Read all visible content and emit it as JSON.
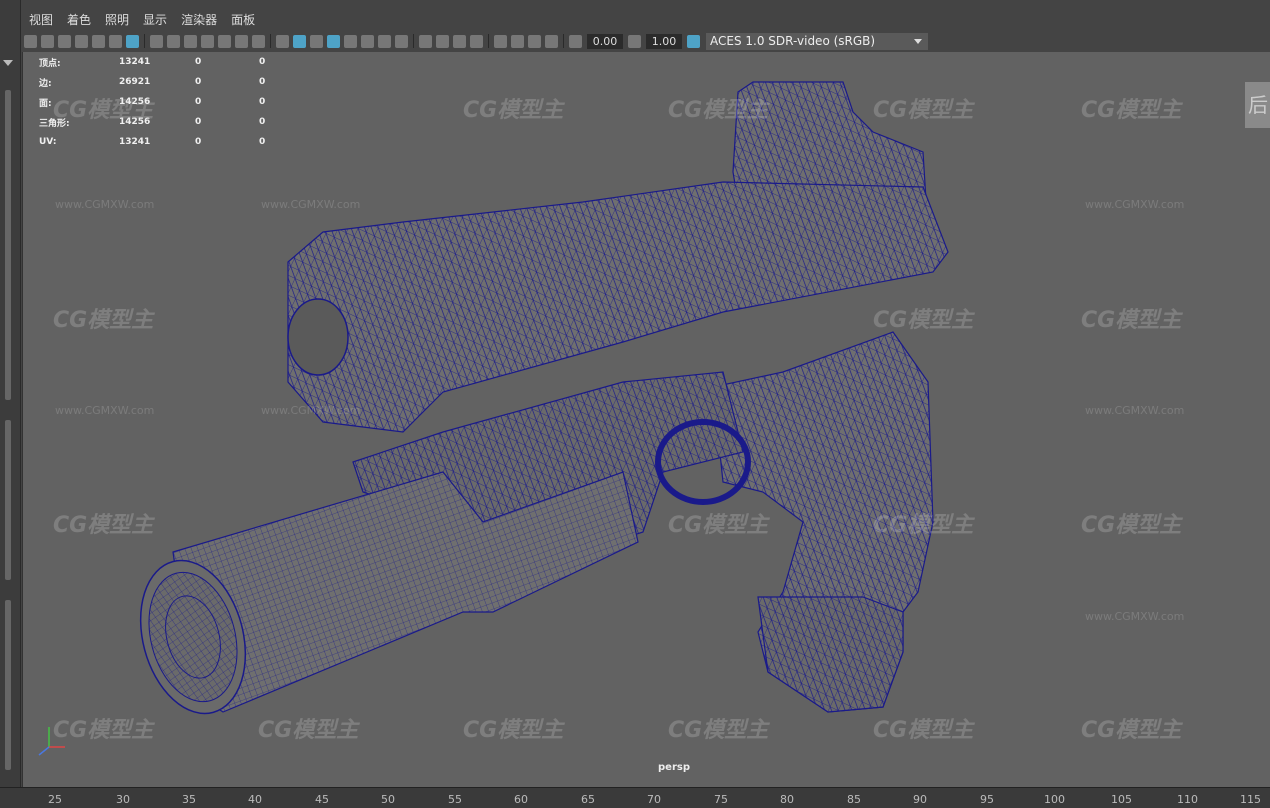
{
  "menu": [
    "视图",
    "着色",
    "照明",
    "显示",
    "渲染器",
    "面板"
  ],
  "toolbar": {
    "exposure": "0.00",
    "gamma": "1.00",
    "color_space": "ACES 1.0 SDR-video (sRGB)"
  },
  "hud": [
    {
      "label": "顶点:",
      "v1": "13241",
      "v2": "0",
      "v3": "0"
    },
    {
      "label": "边:",
      "v1": "26921",
      "v2": "0",
      "v3": "0"
    },
    {
      "label": "面:",
      "v1": "14256",
      "v2": "0",
      "v3": "0"
    },
    {
      "label": "三角形:",
      "v1": "14256",
      "v2": "0",
      "v3": "0"
    },
    {
      "label": "UV:",
      "v1": "13241",
      "v2": "0",
      "v3": "0"
    }
  ],
  "camera": "persp",
  "viewcube_label": "后",
  "watermark": {
    "logo": "CG模型主",
    "url": "www.CGMXW.com"
  },
  "axis": {
    "x": "x",
    "y": "y",
    "z": "z"
  },
  "timeline_ticks": [
    "25",
    "30",
    "35",
    "40",
    "45",
    "50",
    "55",
    "60",
    "65",
    "70",
    "75",
    "80",
    "85",
    "90",
    "95",
    "100",
    "105",
    "110",
    "115"
  ],
  "colors": {
    "wire": "#1a1a8a",
    "mesh": "#6f6f6f",
    "viewport_bg": "#626262"
  }
}
